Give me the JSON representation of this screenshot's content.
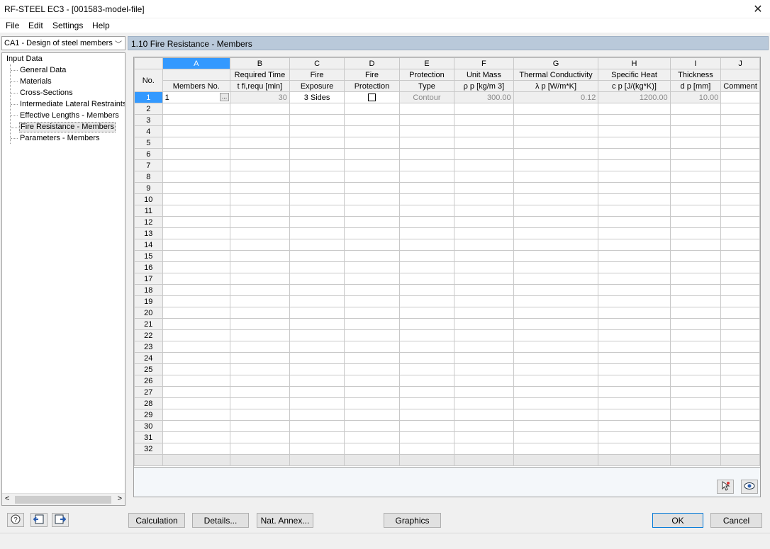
{
  "window": {
    "title": "RF-STEEL EC3 - [001583-model-file]"
  },
  "menu": [
    "File",
    "Edit",
    "Settings",
    "Help"
  ],
  "case_select": {
    "value": "CA1 - Design of steel members"
  },
  "tree": {
    "root": "Input Data",
    "items": [
      "General Data",
      "Materials",
      "Cross-Sections",
      "Intermediate Lateral Restraints",
      "Effective Lengths - Members",
      "Fire Resistance - Members",
      "Parameters - Members"
    ],
    "selected_index": 5
  },
  "panel": {
    "title": "1.10 Fire Resistance - Members"
  },
  "table": {
    "no_header": "No.",
    "columns": [
      {
        "letter": "A",
        "line1": "",
        "line2": "Members No."
      },
      {
        "letter": "B",
        "line1": "Required Time",
        "line2": "t fi,requ [min]"
      },
      {
        "letter": "C",
        "line1": "Fire",
        "line2": "Exposure"
      },
      {
        "letter": "D",
        "line1": "Fire",
        "line2": "Protection"
      },
      {
        "letter": "E",
        "line1": "Protection",
        "line2": "Type"
      },
      {
        "letter": "F",
        "line1": "Unit Mass",
        "line2": "ρ p [kg/m 3]"
      },
      {
        "letter": "G",
        "line1": "Thermal Conductivity",
        "line2": "λ p [W/m*K]"
      },
      {
        "letter": "H",
        "line1": "Specific Heat",
        "line2": "c p [J/(kg*K)]"
      },
      {
        "letter": "I",
        "line1": "Thickness",
        "line2": "d p [mm]"
      },
      {
        "letter": "J",
        "line1": "",
        "line2": "Comment"
      }
    ],
    "row1": {
      "members": "1",
      "ellipsis": "...",
      "time": "30",
      "exposure": "3 Sides",
      "protection_checked": false,
      "type": "Contour",
      "unit_mass": "300.00",
      "conductivity": "0.12",
      "specific_heat": "1200.00",
      "thickness": "10.00",
      "comment": ""
    },
    "row_count": 32
  },
  "buttons": {
    "calculation": "Calculation",
    "details": "Details...",
    "nat_annex": "Nat. Annex...",
    "graphics": "Graphics",
    "ok": "OK",
    "cancel": "Cancel"
  },
  "icons": {
    "help": "help-icon",
    "import": "import-icon",
    "export": "export-icon",
    "pick": "pick-member-icon",
    "view": "eye-icon"
  }
}
